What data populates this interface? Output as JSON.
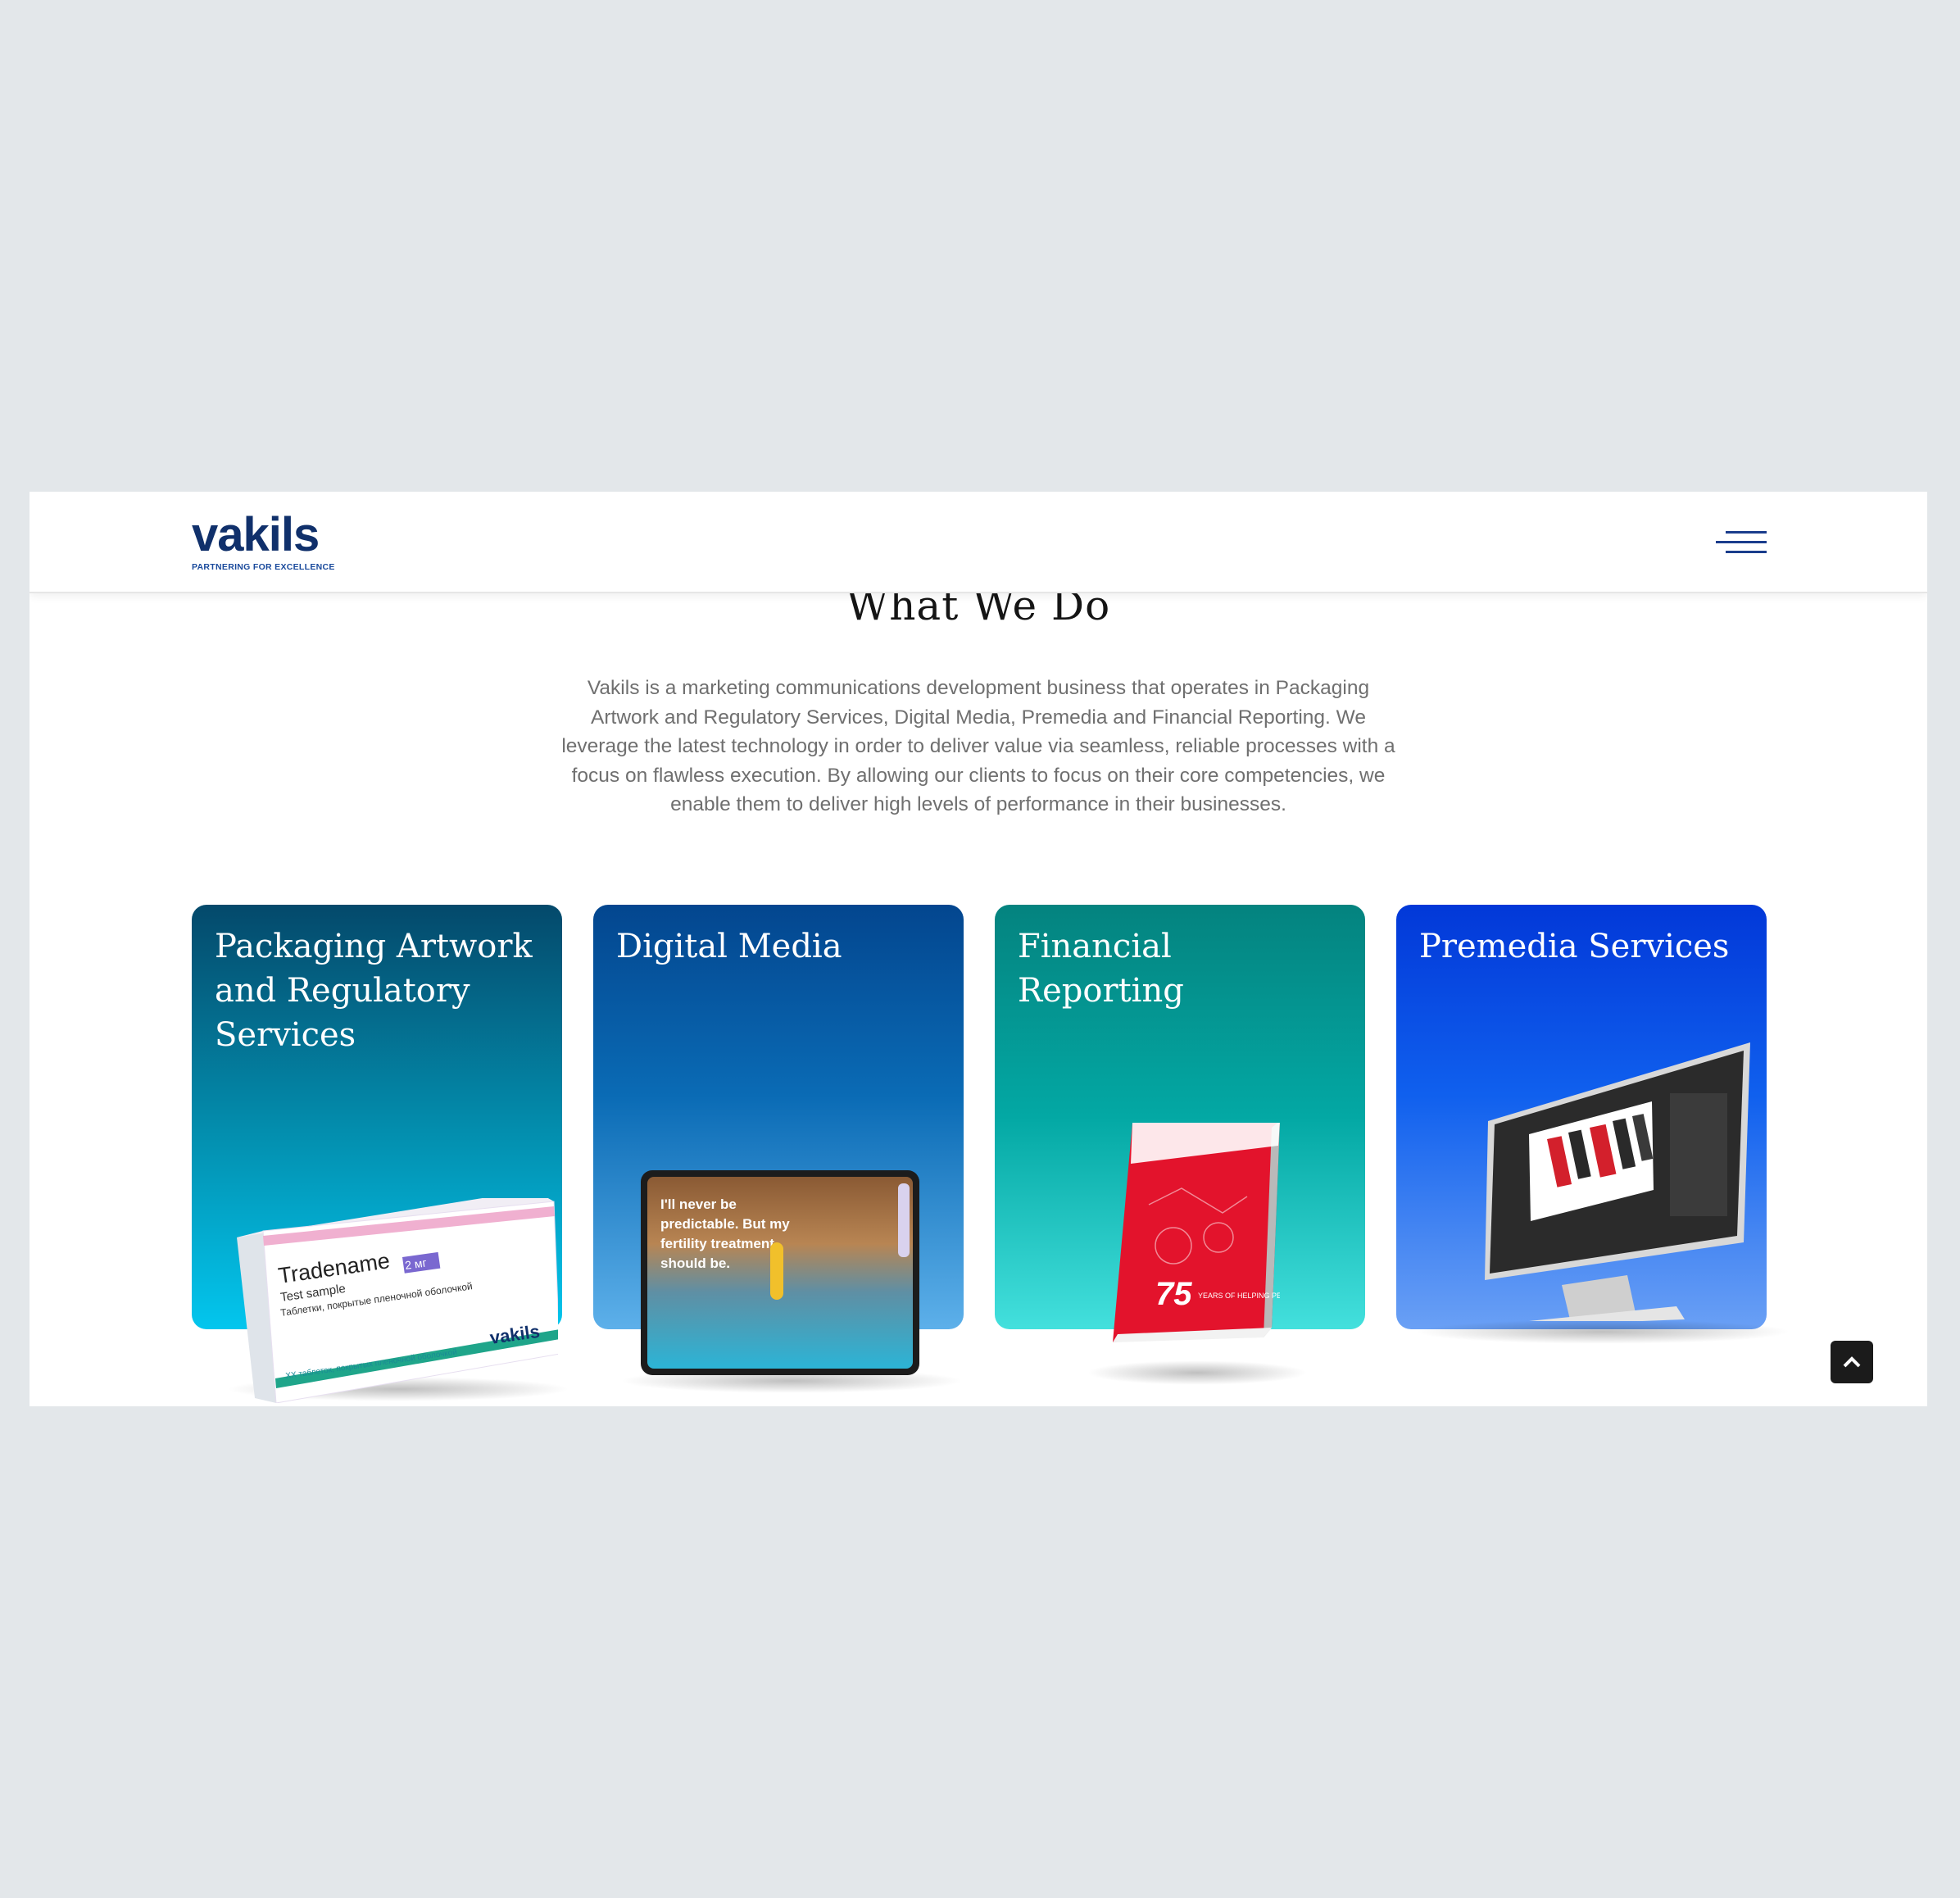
{
  "brand": {
    "name": "vakils",
    "tagline": "PARTNERING FOR EXCELLENCE",
    "color": "#10306b"
  },
  "header": {
    "menu_icon": "hamburger-menu-icon"
  },
  "section": {
    "title": "What We Do",
    "intro": "Vakils is a marketing communications development business that operates in Packaging Artwork and Regulatory Services, Digital Media, Premedia and Financial Reporting. We leverage the latest technology in order to deliver value via seamless, reliable processes with a focus on flawless execution. By allowing our clients to focus on their core competencies, we enable them to deliver high levels of performance in their businesses."
  },
  "services": [
    {
      "title": "Packaging Artwork and Regulatory Services",
      "color": "#0390b0"
    },
    {
      "title": "Digital Media",
      "color": "#0a6bb5"
    },
    {
      "title": "Financial Reporting",
      "color": "#03a8a4"
    },
    {
      "title": "Premedia Services",
      "color": "#1060ee"
    }
  ],
  "mockups": {
    "box": {
      "brand": "Tradename",
      "dose": "2 мг",
      "subtitle": "Test sample",
      "description": "Таблетки, покрытые пленочной оболочкой",
      "count": "XX таблеток, покрытых пленочной оболочкой",
      "logo": "vakils"
    },
    "tablet": {
      "headline": "I'll never be predictable. But my fertility treatment should be."
    },
    "book": {
      "number": "75",
      "caption": "YEARS OF HELPING PEOPLE RISE"
    }
  },
  "scroll_top": {
    "icon": "chevron-up-icon"
  }
}
